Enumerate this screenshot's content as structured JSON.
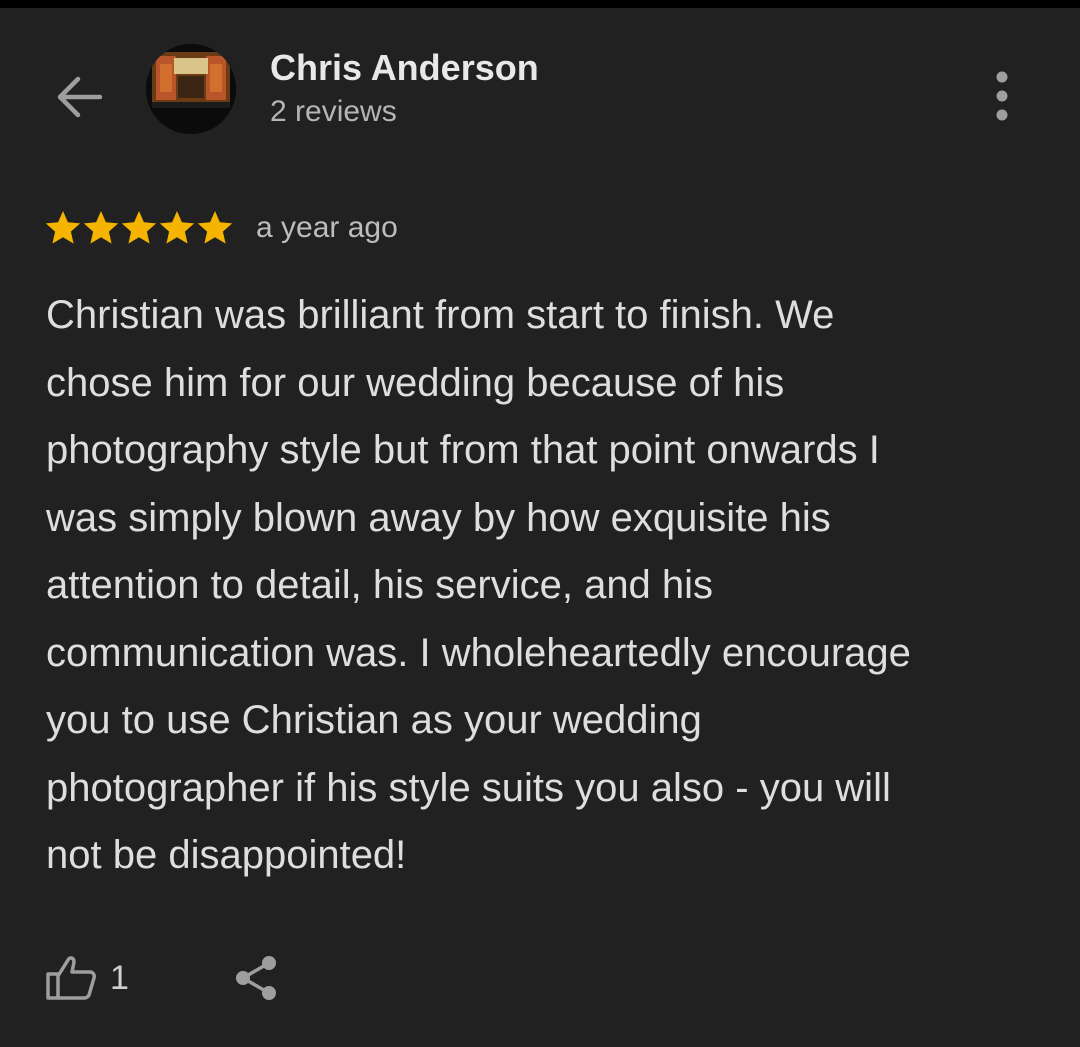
{
  "header": {
    "back_icon": "arrow-left-icon",
    "avatar_icon": "profile-photo",
    "name": "Chris Anderson",
    "review_count_text": "2 reviews",
    "more_icon": "more-vert-icon"
  },
  "review": {
    "rating": 5,
    "rating_max": 5,
    "star_color": "#f4b400",
    "time_ago": "a year ago",
    "text_lines": [
      "Christian was brilliant from start to finish. We",
      "chose him for our wedding because of his",
      "photography style but from that point onwards I",
      "was simply blown away by how exquisite his",
      "attention to detail, his service, and his",
      "communication was. I wholeheartedly encourage",
      "you to use Christian as your wedding",
      "photographer if his style suits you also - you will",
      "not be disappointed!"
    ]
  },
  "actions": {
    "like_icon": "thumb-up-icon",
    "like_count": "1",
    "share_icon": "share-icon"
  },
  "colors": {
    "background": "#212121",
    "text_primary": "#e8e8e8",
    "text_secondary": "#b5b5b5",
    "icon": "#9e9e9e"
  }
}
